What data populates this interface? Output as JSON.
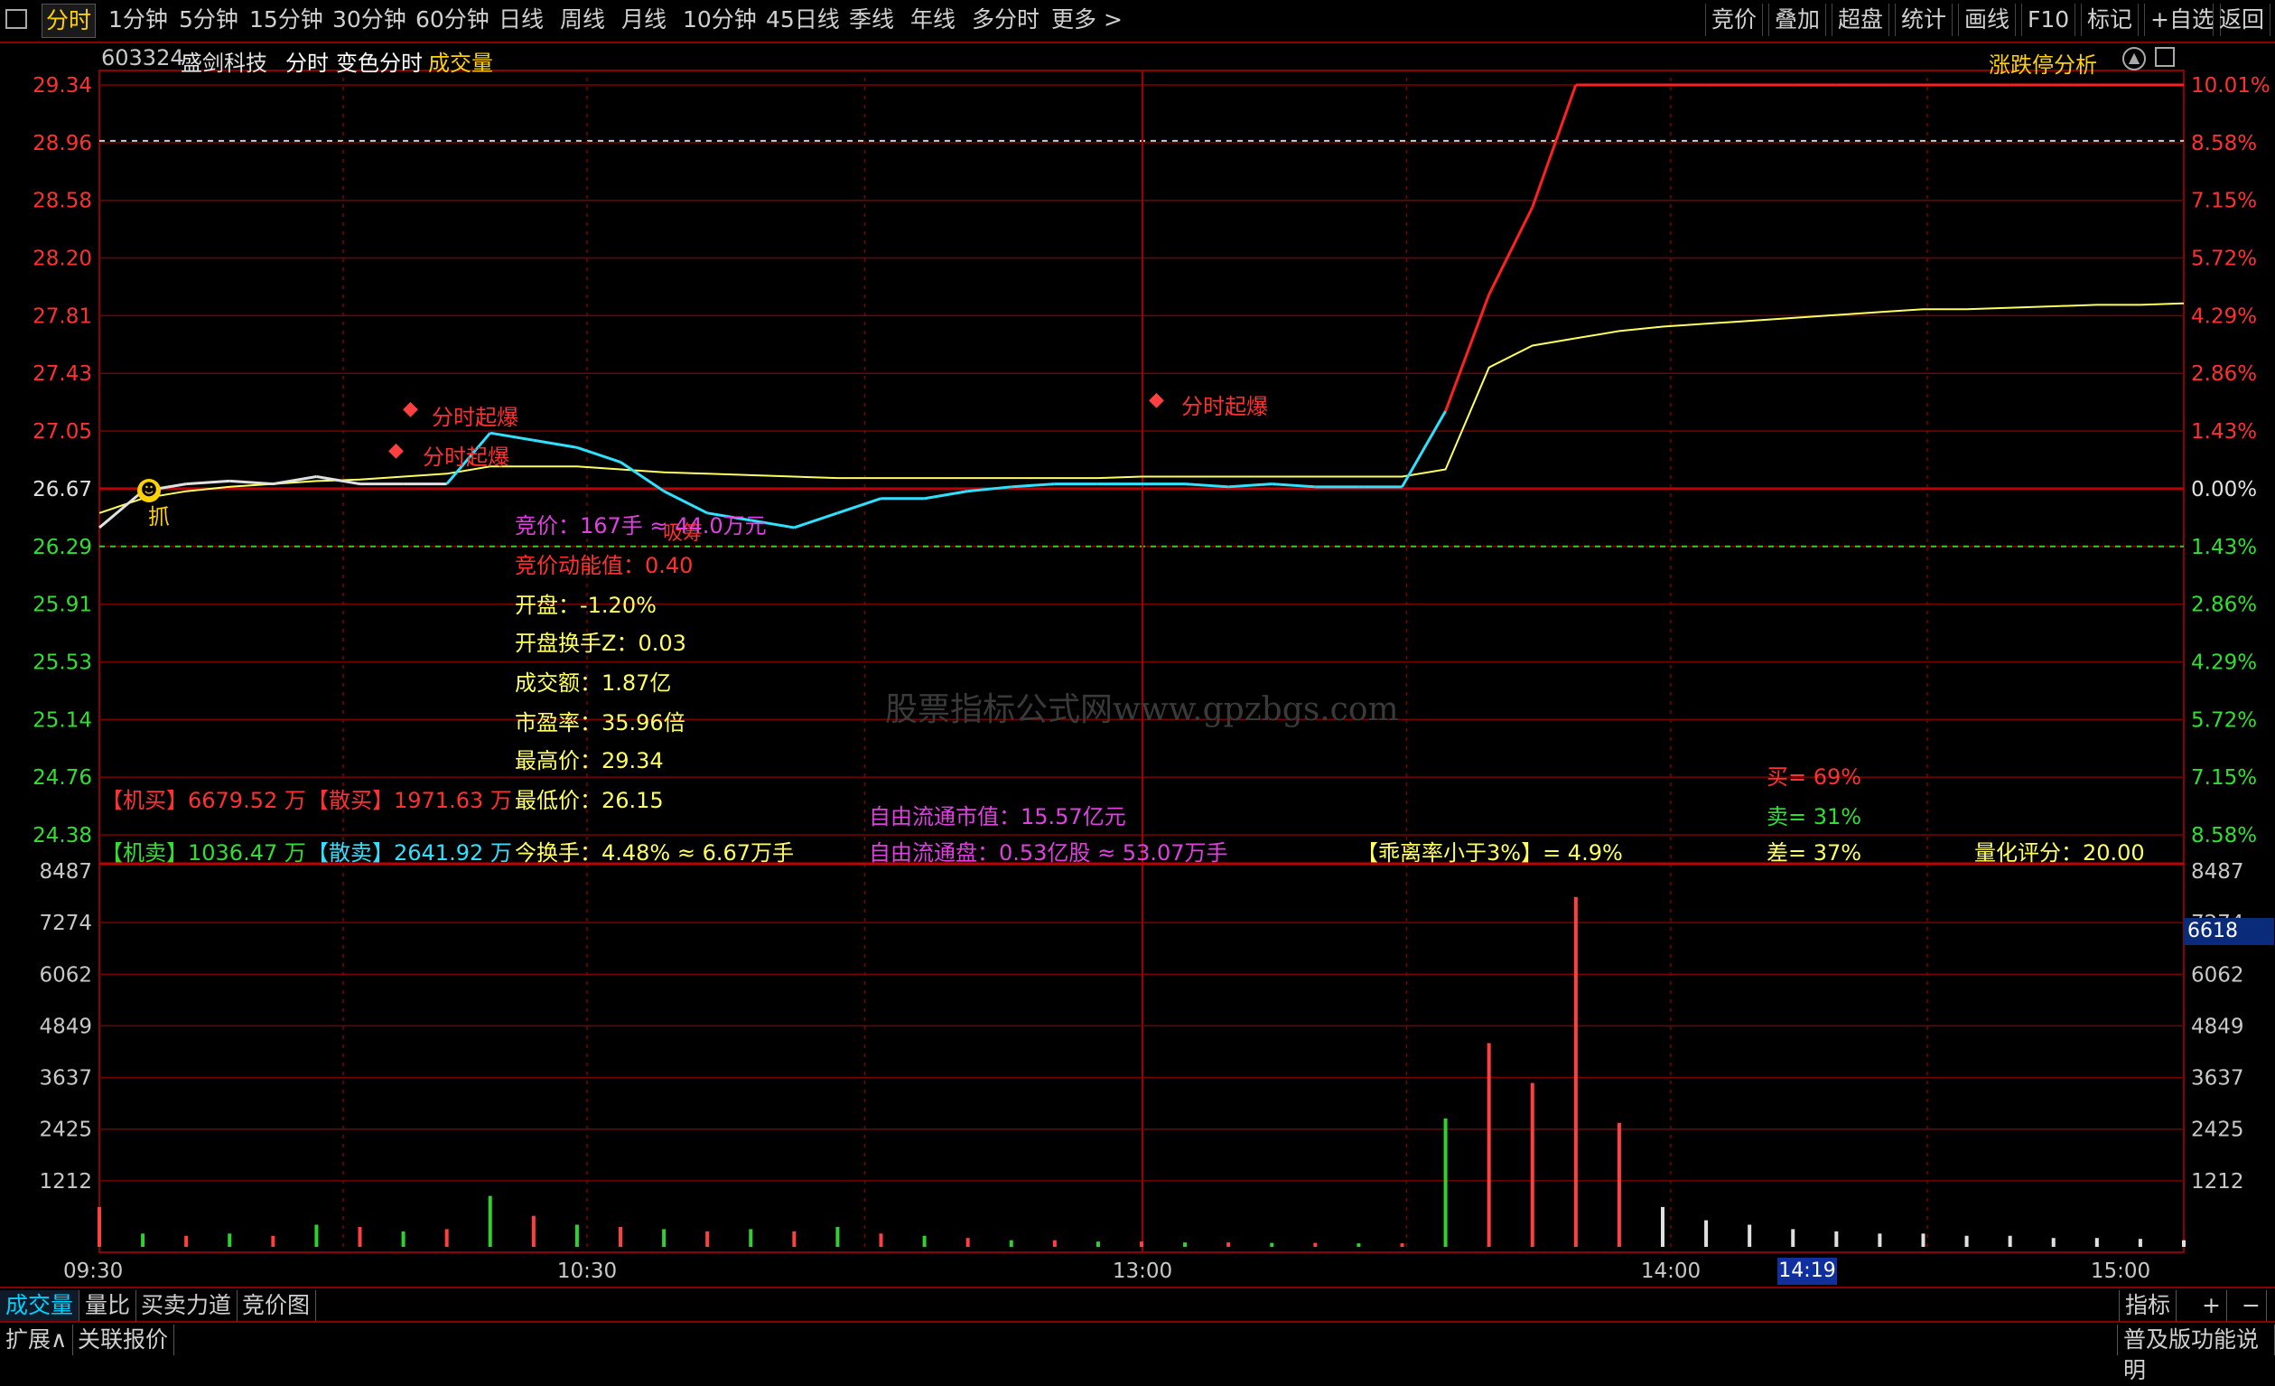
{
  "periods": [
    "分时",
    "1分钟",
    "5分钟",
    "15分钟",
    "30分钟",
    "60分钟",
    "日线",
    "周线",
    "月线",
    "10分钟",
    "45日线",
    "季线",
    "年线",
    "多分时",
    "更多 >"
  ],
  "right_tools": [
    "竞价",
    "叠加",
    "超盘",
    "统计",
    "画线",
    "F10",
    "标记",
    "+自选",
    "返回"
  ],
  "header": {
    "code": "603324",
    "name": "盛剑科技",
    "mode": "分时",
    "mode2": "变色分时",
    "vol": "成交量",
    "limit_analysis": "涨跌停分析"
  },
  "price_axis": [
    "29.34",
    "28.96",
    "28.58",
    "28.20",
    "27.81",
    "27.43",
    "27.05",
    "26.67",
    "26.29",
    "25.91",
    "25.53",
    "25.14",
    "24.76",
    "24.38"
  ],
  "pct_axis": [
    "10.01%",
    "8.58%",
    "7.15%",
    "5.72%",
    "4.29%",
    "2.86%",
    "1.43%",
    "0.00%",
    "1.43%",
    "2.86%",
    "4.29%",
    "5.72%",
    "7.15%",
    "8.58%"
  ],
  "vol_axis": [
    "8487",
    "7274",
    "6062",
    "4849",
    "3637",
    "2425",
    "1212"
  ],
  "vol_axis_right": [
    "8487",
    "7274",
    "6062",
    "4849",
    "3637",
    "2425",
    "1212"
  ],
  "time_axis": [
    "09:30",
    "10:30",
    "13:00",
    "14:00",
    "15:00"
  ],
  "cursor_time": "14:19",
  "cursor_value": "6618",
  "info": {
    "auction": "竞价：167手 ≈ 44.0万元",
    "auction_power": "竞价动能值：0.40",
    "open": "开盘：-1.20%",
    "open_turnover": "开盘换手Z：0.03",
    "amount": "成交额：1.87亿",
    "pe": "市盈率：35.96倍",
    "high": "最高价：29.34",
    "low": "最低价：26.15",
    "turnover": "今换手：4.48% ≈ 6.67万手",
    "float_mv": "自由流通市值：15.57亿元",
    "float_shares": "自由流通盘：0.53亿股 ≈ 53.07万手",
    "inst_buy": "【机买】6679.52 万",
    "retail_buy": "【散买】1971.63 万",
    "inst_sell": "【机卖】1036.47 万",
    "retail_sell": "【散卖】2641.92 万",
    "deviation": "【乖离率小于3%】= 4.9%",
    "buy_pct": "买= 69%",
    "sell_pct": "卖= 31%",
    "diff_pct": "差= 37%",
    "score": "量化评分：20.00"
  },
  "markers": {
    "burst1": "分时起爆",
    "burst2": "分时起爆",
    "burst3": "分时起爆",
    "catch": "抓",
    "absorb": "吸筹"
  },
  "watermark": "股票指标公式网www.gpzbgs.com",
  "bottom_tabs": [
    "成交量",
    "量比",
    "买卖力道",
    "竞价图"
  ],
  "bottom_right": [
    "指标",
    "+",
    "−"
  ],
  "footer_left": [
    "扩展∧",
    "关联报价"
  ],
  "footer_right": "普及版功能说明",
  "chart_data": {
    "type": "line",
    "prev_close": 26.67,
    "ylim": [
      24.19,
      29.34
    ],
    "x_minutes": [
      0,
      5,
      10,
      15,
      20,
      25,
      30,
      35,
      40,
      45,
      50,
      55,
      60,
      65,
      70,
      75,
      80,
      85,
      90,
      95,
      100,
      105,
      110,
      115,
      120,
      125,
      130,
      135,
      140,
      145,
      150,
      155,
      160,
      165,
      170,
      175,
      180,
      185,
      190,
      195,
      200,
      205,
      210,
      215,
      220,
      225,
      230,
      235,
      240
    ],
    "price": [
      26.3,
      26.55,
      26.6,
      26.62,
      26.6,
      26.65,
      26.6,
      26.6,
      26.6,
      26.95,
      26.9,
      26.85,
      26.75,
      26.55,
      26.4,
      26.35,
      26.3,
      26.4,
      26.5,
      26.5,
      26.55,
      26.58,
      26.6,
      26.6,
      26.6,
      26.6,
      26.58,
      26.6,
      26.58,
      26.58,
      26.58,
      27.1,
      27.9,
      28.5,
      29.34,
      29.34,
      29.34,
      29.34,
      29.34,
      29.34,
      29.34,
      29.34,
      29.34,
      29.34,
      29.34,
      29.34,
      29.34,
      29.34,
      29.34
    ],
    "avg": [
      26.4,
      26.5,
      26.55,
      26.58,
      26.6,
      26.62,
      26.63,
      26.65,
      26.67,
      26.72,
      26.72,
      26.72,
      26.7,
      26.68,
      26.67,
      26.66,
      26.65,
      26.64,
      26.64,
      26.64,
      26.64,
      26.64,
      26.64,
      26.64,
      26.65,
      26.65,
      26.65,
      26.65,
      26.65,
      26.65,
      26.65,
      26.7,
      27.4,
      27.55,
      27.6,
      27.65,
      27.68,
      27.7,
      27.72,
      27.74,
      27.76,
      27.78,
      27.8,
      27.8,
      27.81,
      27.82,
      27.83,
      27.83,
      27.84
    ],
    "volume": [
      900,
      300,
      250,
      300,
      250,
      500,
      450,
      350,
      400,
      1150,
      700,
      500,
      450,
      400,
      350,
      400,
      350,
      450,
      300,
      250,
      200,
      150,
      150,
      120,
      120,
      100,
      100,
      90,
      90,
      80,
      80,
      2900,
      4600,
      3700,
      7900,
      2800,
      900,
      600,
      500,
      400,
      350,
      300,
      300,
      250,
      250,
      200,
      200,
      180,
      150
    ]
  }
}
